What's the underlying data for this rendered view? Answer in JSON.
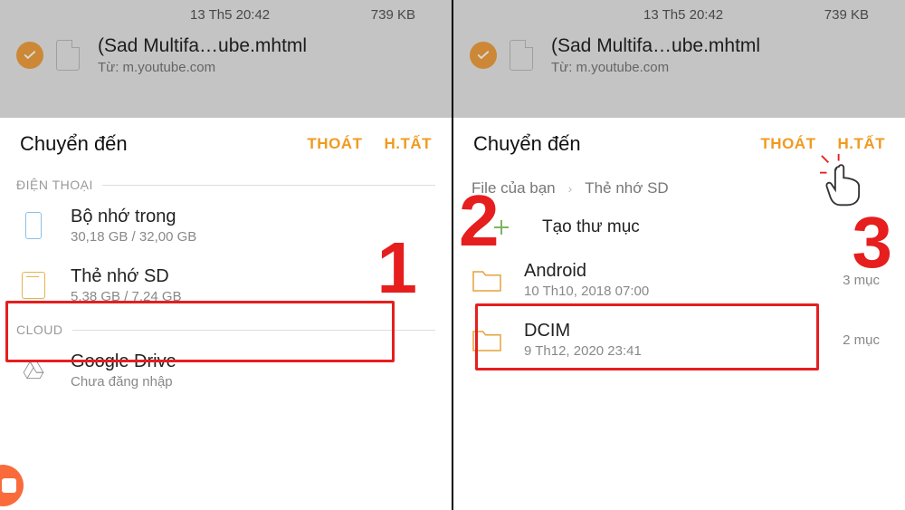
{
  "background": {
    "file_timestamp": "13 Th5 20:42",
    "file_size": "739 KB",
    "filename": "(Sad Multifa…ube.mhtml",
    "source": "Từ: m.youtube.com"
  },
  "sheet": {
    "title": "Chuyển đến",
    "cancel_label": "THOÁT",
    "done_label": "H.TẤT"
  },
  "left": {
    "section_phone": "ĐIỆN THOẠI",
    "section_cloud": "CLOUD",
    "internal": {
      "title": "Bộ nhớ trong",
      "subtitle": "30,18 GB / 32,00 GB"
    },
    "sd": {
      "title": "Thẻ nhớ SD",
      "subtitle": "5,38 GB / 7,24 GB"
    },
    "drive": {
      "title": "Google Drive",
      "subtitle": "Chưa đăng nhập"
    }
  },
  "right": {
    "breadcrumb_root": "File của bạn",
    "breadcrumb_current": "Thẻ nhớ SD",
    "create_folder": "Tạo thư mục",
    "folders": [
      {
        "name": "Android",
        "subtitle": "10 Th10, 2018 07:00",
        "count": "3 mục"
      },
      {
        "name": "DCIM",
        "subtitle": "9 Th12, 2020 23:41",
        "count": "2 mục"
      }
    ]
  },
  "annotations": {
    "step1": "1",
    "step2": "2",
    "step3": "3"
  }
}
